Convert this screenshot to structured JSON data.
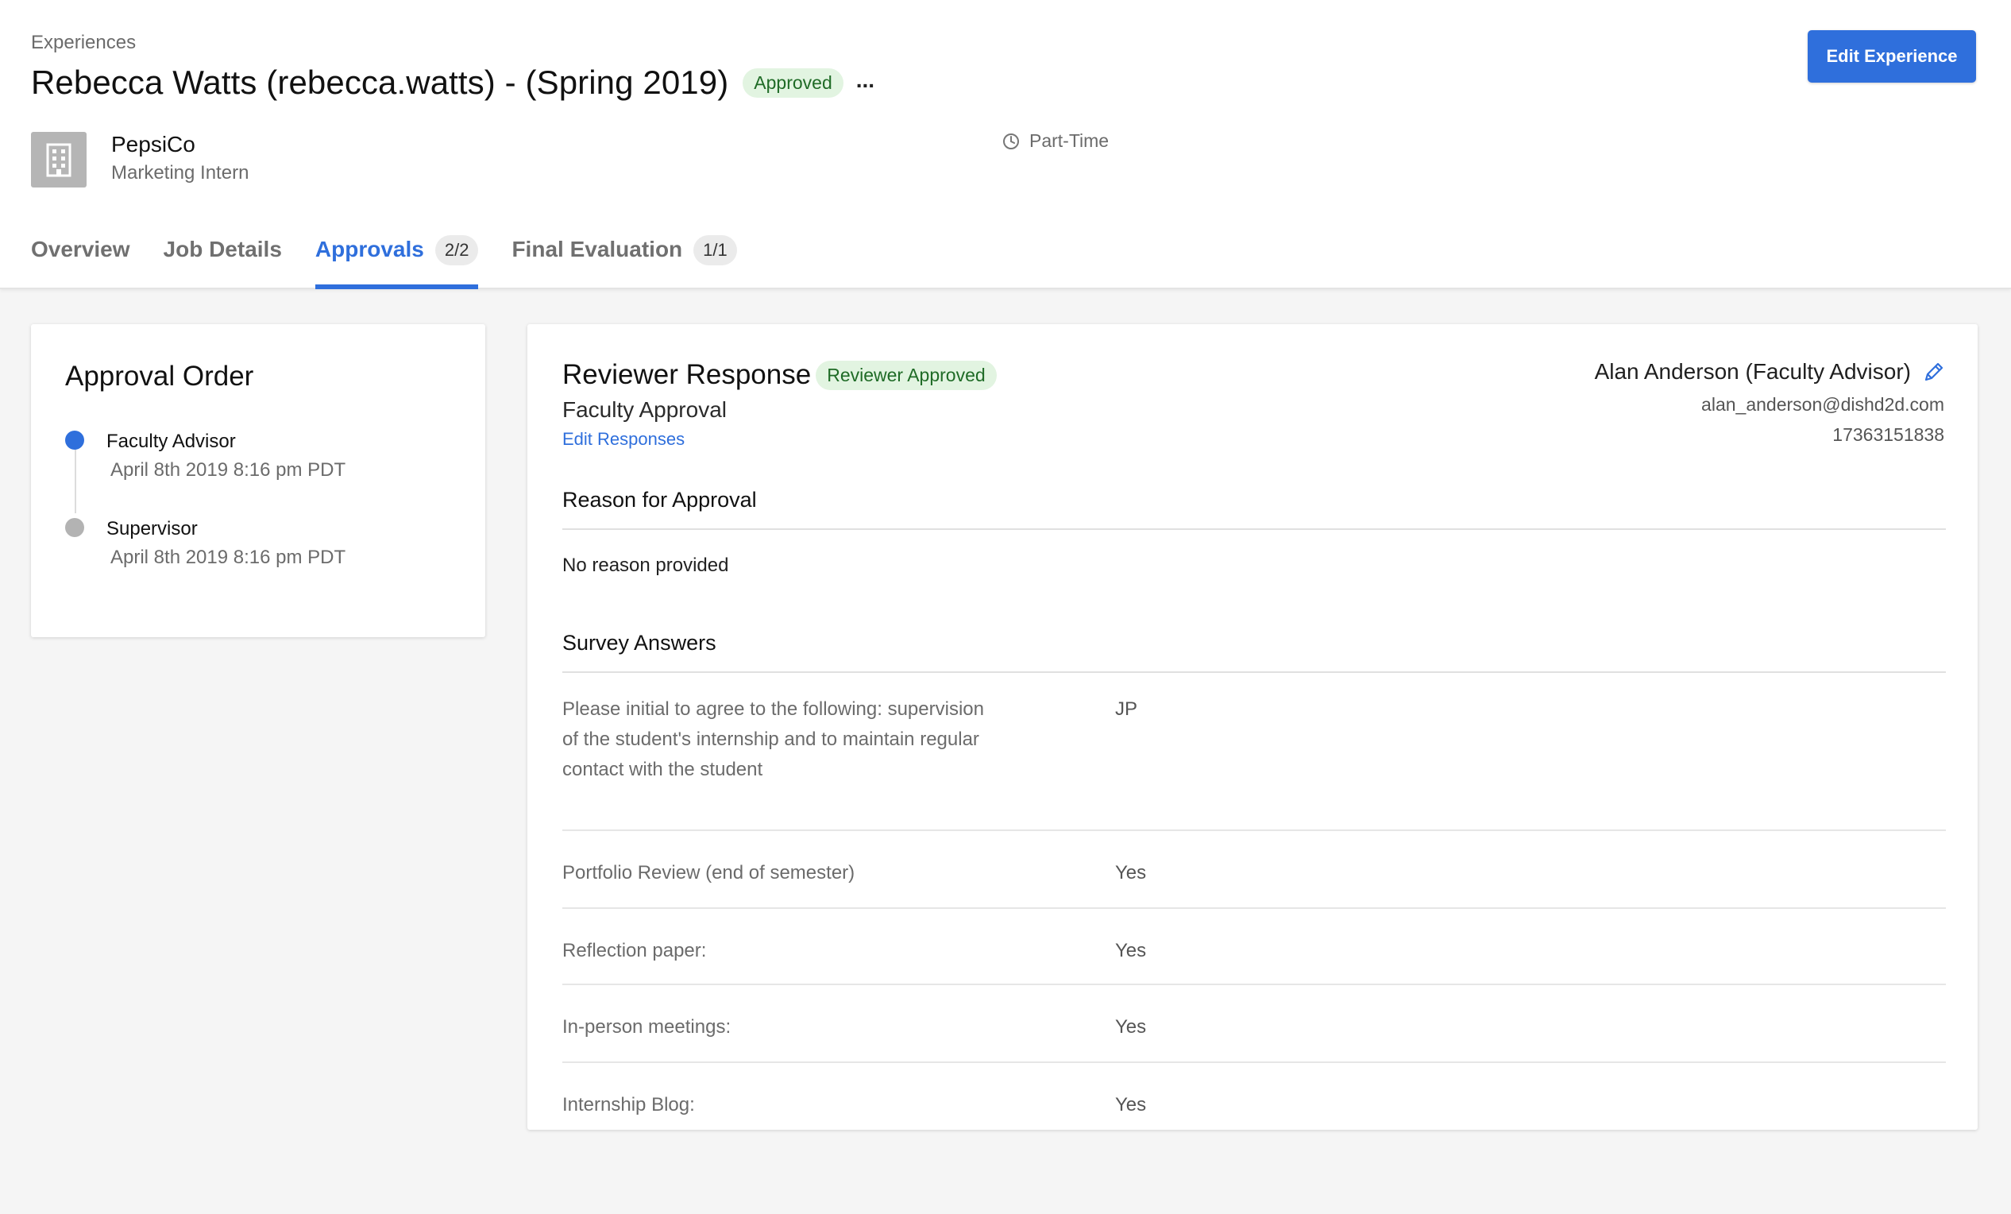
{
  "header": {
    "breadcrumb": "Experiences",
    "title": "Rebecca Watts (rebecca.watts) - (Spring 2019)",
    "status": "Approved",
    "more": "...",
    "edit_button": "Edit Experience",
    "company": "PepsiCo",
    "job_title": "Marketing Intern",
    "job_type": "Part-Time"
  },
  "tabs": [
    {
      "label": "Overview",
      "count": ""
    },
    {
      "label": "Job Details",
      "count": ""
    },
    {
      "label": "Approvals",
      "count": "2/2"
    },
    {
      "label": "Final Evaluation",
      "count": "1/1"
    }
  ],
  "approval_order": {
    "title": "Approval Order",
    "steps": [
      {
        "name": "Faculty Advisor",
        "date": "April 8th 2019 8:16 pm PDT",
        "color": "#2f6fdc"
      },
      {
        "name": "Supervisor",
        "date": "April 8th 2019 8:16 pm PDT",
        "color": "#b3b3b3"
      }
    ]
  },
  "response": {
    "title": "Reviewer Response",
    "badge": "Reviewer Approved",
    "subtitle": "Faculty Approval",
    "edit_link": "Edit Responses",
    "reviewer_name": "Alan Anderson (Faculty Advisor)",
    "reviewer_email": "alan_anderson@dishd2d.com",
    "reviewer_phone": "17363151838",
    "reason_heading": "Reason for Approval",
    "reason_text": "No reason provided",
    "survey_heading": "Survey Answers",
    "survey": [
      {
        "question": "Please initial to agree to the following: supervision of the student's internship and to maintain regular contact with the student",
        "answer": "JP"
      },
      {
        "question": "Portfolio Review (end of semester)",
        "answer": "Yes"
      },
      {
        "question": "Reflection paper:",
        "answer": "Yes"
      },
      {
        "question": "In-person meetings:",
        "answer": "Yes"
      },
      {
        "question": "Internship Blog:",
        "answer": "Yes"
      }
    ]
  },
  "colors": {
    "accent": "#2f6fdc",
    "approved_bg": "#e2f4e1",
    "approved_text": "#1f6b26"
  }
}
